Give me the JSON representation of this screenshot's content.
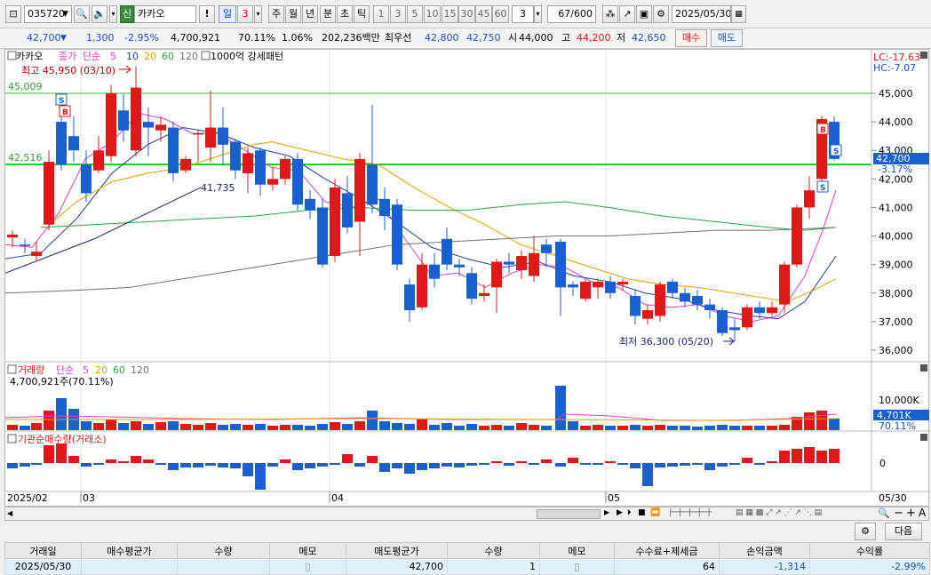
{
  "toolbar": {
    "code": "035720",
    "code_arrow": "▼",
    "sin_label": "신",
    "name": "카카오",
    "excl": "!",
    "period_day": "일",
    "period_num": "3",
    "periods": [
      "주",
      "월",
      "년",
      "분",
      "초",
      "틱"
    ],
    "nums": [
      "1",
      "3",
      "5",
      "10",
      "15",
      "30",
      "45",
      "60"
    ],
    "count_sel": "3",
    "count": "67",
    "count_total": "/600",
    "date": "2025/05/30"
  },
  "quote": {
    "price": "42,700",
    "price_arrow": "▼",
    "change": "1,300",
    "pct": "-2.95%",
    "volume": "4,700,921",
    "vol_ratio": "70.11%",
    "turnover": "1.06%",
    "amount": "202,236백만",
    "bid_label": "최우선",
    "ask": "42,800",
    "bid": "42,750",
    "open_label": "시",
    "open": "44,000",
    "high_label": "고",
    "high": "44,200",
    "low_label": "저",
    "low": "42,650",
    "buy_label": "매수",
    "sell_label": "매도"
  },
  "chart": {
    "legend_name": "카카오",
    "legend_price": "종가",
    "legend_ma": "단순",
    "legend_periods": [
      "5",
      "10",
      "20",
      "60",
      "120"
    ],
    "legend_extra": "1000억 강세패턴",
    "high_marker": "최고 45,950 (03/10)",
    "low_marker": "최저 36,300 (05/20)",
    "mid_marker": "41,735",
    "lc": "LC:-17.63",
    "hc": "HC:-7.07",
    "line_upper": "45,009",
    "line_lower": "42,516",
    "cur_price": "42,700",
    "cur_pct": "-3.17%",
    "yticks": [
      "45,000",
      "44,000",
      "43,000",
      "42,000",
      "41,000",
      "40,000",
      "39,000",
      "38,000",
      "37,000",
      "36,000"
    ],
    "vol_legend": "거래량",
    "vol_ma_label": "단순",
    "vol_periods": [
      "5",
      "20",
      "60",
      "120"
    ],
    "vol_value": "4,700,921주(70.11%)",
    "vol_tick": "10,000K",
    "vol_cur": "4,701K",
    "vol_cur_pct": "70.11%",
    "inst_legend": "기관순매수량(거래소)",
    "inst_zero": "0",
    "xlabels": [
      "2025/02",
      "03",
      "04",
      "05",
      "05/30"
    ],
    "colors": {
      "up": "#e01818",
      "down": "#1a5fd0",
      "ma5": "#e040c0",
      "ma10": "#2040a0",
      "ma20": "#e0a000",
      "ma60": "#30a040",
      "ma120": "#707070"
    }
  },
  "grid": {
    "headers": [
      "거래일",
      "매수평균가",
      "수량",
      "메모",
      "매도평균가",
      "수량",
      "메모",
      "수수료+제세금",
      "손익금액",
      "수익률"
    ],
    "row": [
      "2025/05/30",
      "",
      "",
      "",
      "42,700",
      "1",
      "",
      "64",
      "-1,314",
      "-2.99%"
    ],
    "next_label": "다음"
  }
}
